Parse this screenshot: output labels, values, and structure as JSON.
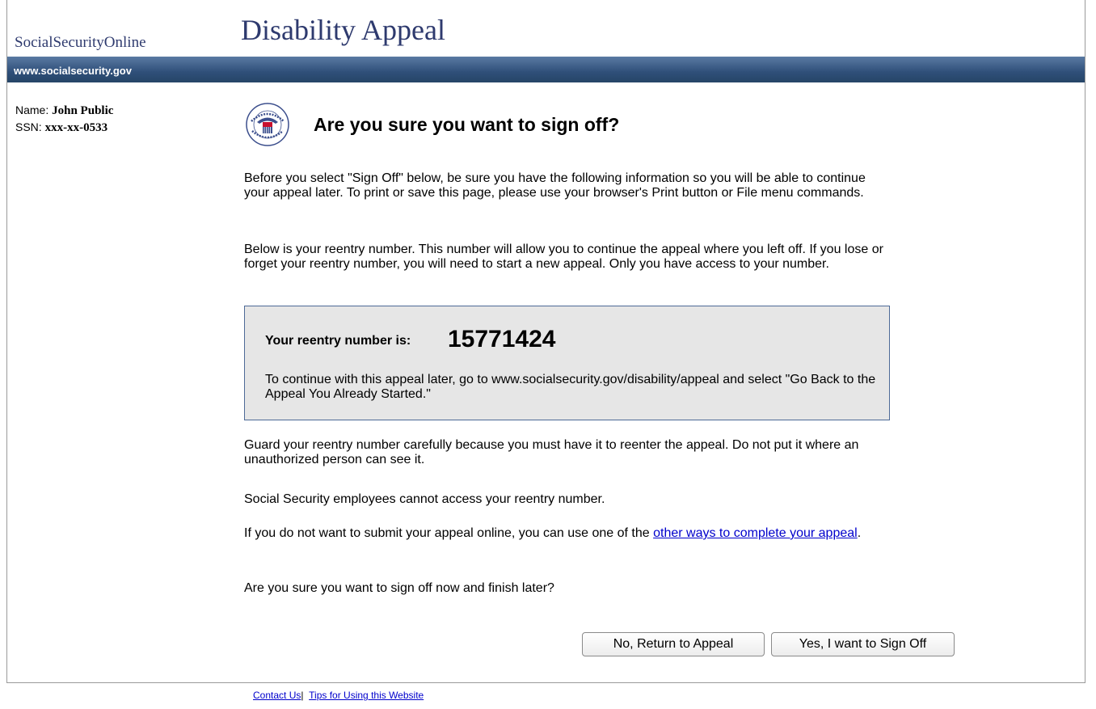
{
  "header": {
    "site_name": "SocialSecurityOnline",
    "page_heading": "Disability Appeal",
    "url_text": "www.socialsecurity.gov"
  },
  "user": {
    "name_label": "Name:",
    "name_value": "John Public",
    "ssn_label": "SSN:",
    "ssn_value": "xxx-xx-0533"
  },
  "main": {
    "seal_text": "USA",
    "title": "Are you sure you want to sign off?",
    "para1": "Before you select \"Sign Off\" below, be sure you have the following information so you will be able to continue your appeal later. To print or save this page, please use your browser's Print button or File menu commands.",
    "para2": "Below is your reentry number. This number will allow you to continue the appeal where you left off. If you lose or forget your reentry number, you will need to start a new appeal. Only you have access to your number.",
    "reentry_label": "Your reentry number is:",
    "reentry_number": "15771424",
    "reentry_note": "To continue with this appeal later, go to www.socialsecurity.gov/disability/appeal and select \"Go Back to the Appeal You Already Started.\"",
    "para3": "Guard your reentry number carefully because you must have it to reenter the appeal. Do not put it where an unauthorized person can see it.",
    "para4": "Social Security employees cannot access your reentry number.",
    "para5_prefix": "If you do not want to submit your appeal online, you can use one of the ",
    "para5_link": "other ways to complete your appeal",
    "para5_suffix": ".",
    "para6": "Are you sure you want to sign off now and finish later?"
  },
  "buttons": {
    "return_label": "No, Return to Appeal",
    "signoff_label": "Yes, I want to Sign Off"
  },
  "footer": {
    "contact": "Contact Us",
    "separator": "|",
    "tips": "Tips for Using this Website"
  },
  "colors": {
    "heading": "#2e3a6e",
    "urlbar": "#2f4f79",
    "box_bg": "#e6e6e6",
    "link": "#0000cc"
  }
}
